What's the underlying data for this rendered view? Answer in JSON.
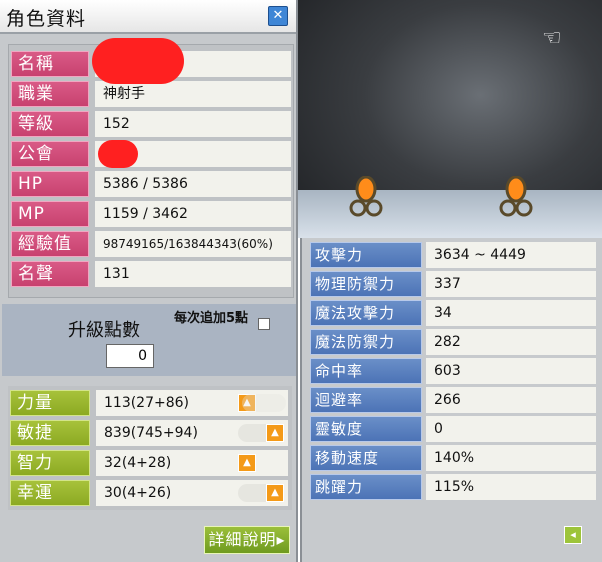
{
  "window": {
    "title": "角色資料",
    "close_icon": "close-icon"
  },
  "profile": [
    {
      "label": "名稱",
      "value": ""
    },
    {
      "label": "職業",
      "value": "神射手"
    },
    {
      "label": "等級",
      "value": "152"
    },
    {
      "label": "公會",
      "value": ""
    },
    {
      "label": "HP",
      "value": "5386 / 5386"
    },
    {
      "label": "MP",
      "value": "1159 / 3462"
    },
    {
      "label": "經驗值",
      "value": "98749165/163844343(60%)"
    },
    {
      "label": "名聲",
      "value": "131"
    }
  ],
  "level_up": {
    "label": "升級點數",
    "value": "0",
    "auto_add_label": "每次追加5點",
    "auto_add_checked": false
  },
  "stats": [
    {
      "label": "力量",
      "value": "113(27+86)"
    },
    {
      "label": "敏捷",
      "value": "839(745+94)"
    },
    {
      "label": "智力",
      "value": "32(4+28)"
    },
    {
      "label": "幸運",
      "value": "30(4+26)"
    }
  ],
  "detail_button": "詳細說明",
  "battle_stats": [
    {
      "label": "攻擊力",
      "value": "3634 ~ 4449"
    },
    {
      "label": "物理防禦力",
      "value": "337"
    },
    {
      "label": "魔法攻擊力",
      "value": "34"
    },
    {
      "label": "魔法防禦力",
      "value": "282"
    },
    {
      "label": "命中率",
      "value": "603"
    },
    {
      "label": "迴避率",
      "value": "266"
    },
    {
      "label": "靈敏度",
      "value": "0"
    },
    {
      "label": "移動速度",
      "value": "140%"
    },
    {
      "label": "跳躍力",
      "value": "115%"
    }
  ],
  "colors": {
    "pink_label": "#cc4a78",
    "green_label": "#99b42c",
    "blue_label": "#5a7fc0",
    "up_button": "#f49a18"
  }
}
